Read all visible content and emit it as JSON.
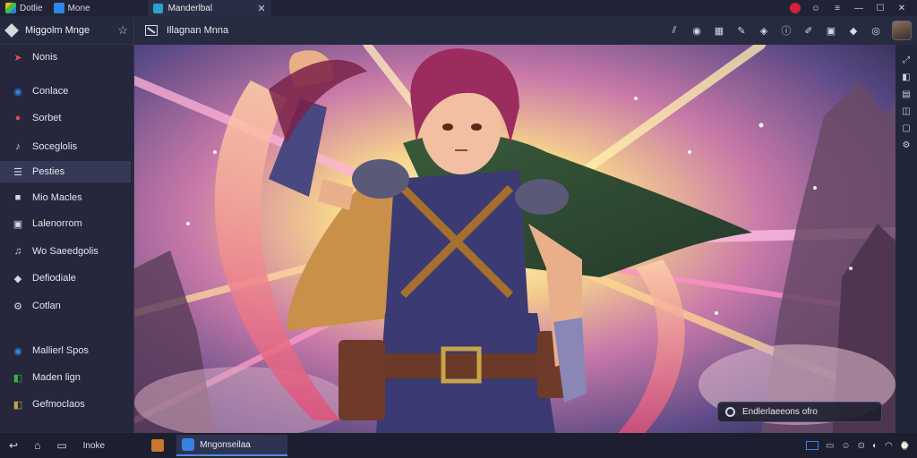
{
  "topbar": {
    "app_label": "Dotlie",
    "home_label": "Mone",
    "tab_label": "Manderlbal",
    "close_glyph": "✕"
  },
  "sidebar": {
    "title": "Miggolm Mnge",
    "items": [
      {
        "label": "Nonis",
        "icon": "pin-icon",
        "color": "#e0505a"
      },
      {
        "label": "Conlace",
        "icon": "circle-c-icon",
        "color": "#2f86e8"
      },
      {
        "label": "Sorbet",
        "icon": "chat-icon",
        "color": "#e04858"
      },
      {
        "label": "Soceglolis",
        "icon": "music-icon",
        "color": "#d8d8e2"
      },
      {
        "label": "Pesties",
        "icon": "list-icon",
        "color": "#d8d8e2"
      },
      {
        "label": "Mio Macles",
        "icon": "square-icon",
        "color": "#d8d8e2"
      },
      {
        "label": "Lalenorrom",
        "icon": "box-icon",
        "color": "#d8d8e2"
      },
      {
        "label": "Wo Saeedgolis",
        "icon": "note-icon",
        "color": "#d8d8e2"
      },
      {
        "label": "Defiodiale",
        "icon": "tag-icon",
        "color": "#d8d8e2"
      },
      {
        "label": "Cotlan",
        "icon": "gear-icon",
        "color": "#d8d8e2"
      },
      {
        "label": "Mallierl Spos",
        "icon": "globe-icon",
        "color": "#2f86e8"
      },
      {
        "label": "Maden lign",
        "icon": "cube-icon",
        "color": "#38b04a"
      },
      {
        "label": "Gefmoclaos",
        "icon": "cube-icon",
        "color": "#c9a24a"
      }
    ],
    "active_index": 4
  },
  "content": {
    "title": "Illagnan Mnna"
  },
  "toast": {
    "text": "Endlerlaeeons ofro"
  },
  "taskbar": {
    "label": "Inoke",
    "app_label": "Mngonseilaa"
  }
}
